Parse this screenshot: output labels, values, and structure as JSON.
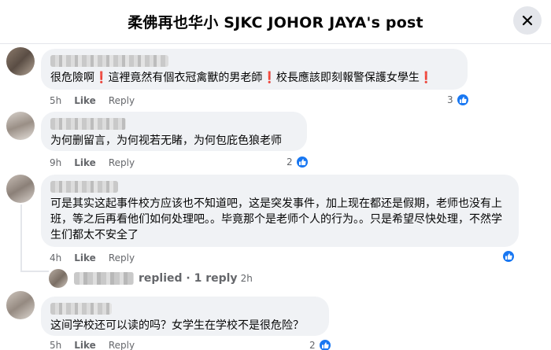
{
  "header": {
    "title": "柔佛再也华小 SJKC JOHOR JAYA's post",
    "close_icon": "close-icon"
  },
  "comments": [
    {
      "text_parts": [
        "很危險啊",
        "這裡竟然有個衣冠禽獸的男老師",
        "校長應該即刻報警保護女學生"
      ],
      "time": "5h",
      "like_label": "Like",
      "reply_label": "Reply",
      "reaction_count": "3"
    },
    {
      "text": "为何删留言，为何视若无睹，为何包庇色狼老师",
      "time": "9h",
      "like_label": "Like",
      "reply_label": "Reply",
      "reaction_count": "2"
    },
    {
      "text": "可是其实这起事件校方应该也不知道吧，这是突发事件，加上现在都还是假期，老师也没有上班，等之后再看他们如何处理吧。。毕竟那个是老师个人的行为。。只是希望尽快处理，不然学生们都太不安全了",
      "time": "4h",
      "like_label": "Like",
      "reply_label": "Reply",
      "reaction_count": ""
    },
    {
      "text": "这间学校还可以读的吗？女学生在学校不是很危险？",
      "time": "5h",
      "like_label": "Like",
      "reply_label": "Reply",
      "reaction_count": "2"
    }
  ],
  "replies_summary": {
    "label": "replied · 1 reply",
    "time": "2h"
  },
  "colors": {
    "like_blue": "#1877f2",
    "bubble_bg": "#f0f2f5",
    "meta_gray": "#65676b",
    "exclaim_red": "#e0245e"
  }
}
